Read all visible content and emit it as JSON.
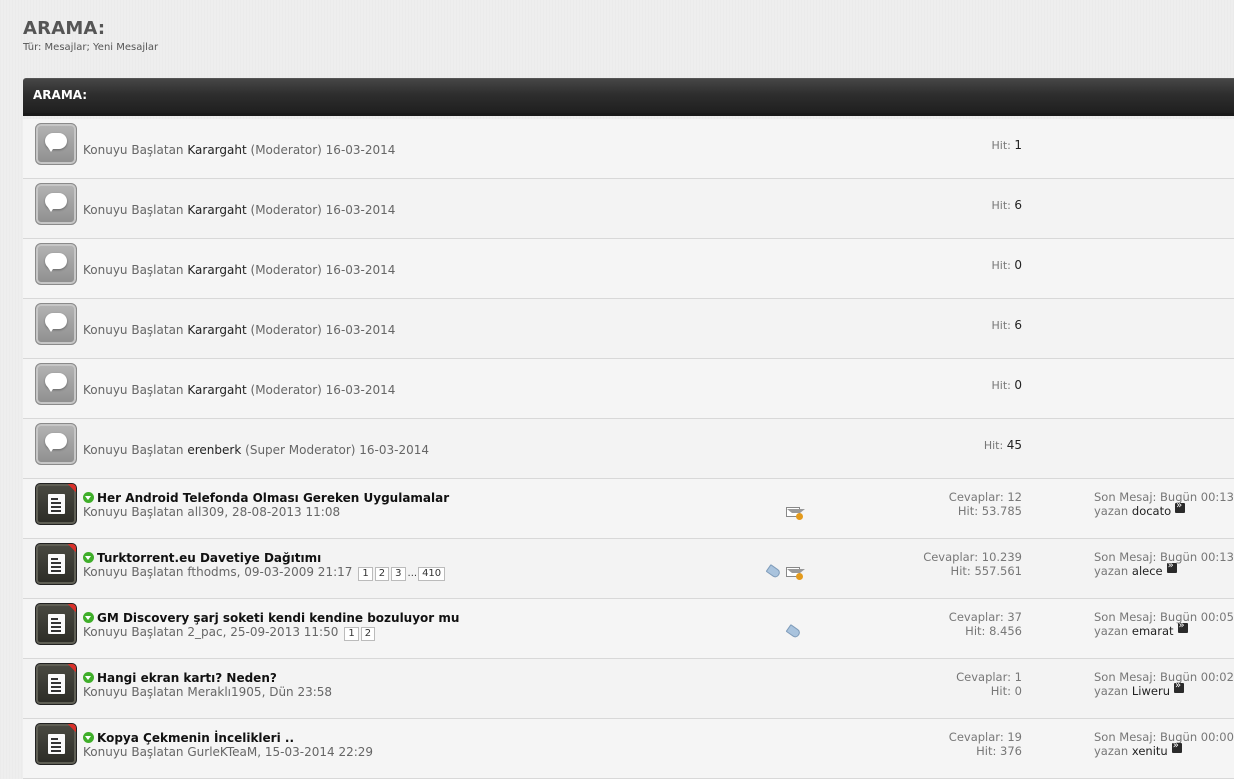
{
  "page": {
    "title": "ARAMA:",
    "subtitle": "Tür: Mesajlar; Yeni Mesajlar",
    "bar_title": "ARAMA:"
  },
  "labels": {
    "started_by": "Konuyu Başlatan",
    "hit": "Hit:",
    "replies": "Cevaplar:",
    "last_post": "Son Mesaj:",
    "by": "yazan"
  },
  "simple_rows": [
    {
      "author": "Karargaht",
      "role": "(Moderator)",
      "date": "16-03-2014",
      "hits": "1"
    },
    {
      "author": "Karargaht",
      "role": "(Moderator)",
      "date": "16-03-2014",
      "hits": "6"
    },
    {
      "author": "Karargaht",
      "role": "(Moderator)",
      "date": "16-03-2014",
      "hits": "0"
    },
    {
      "author": "Karargaht",
      "role": "(Moderator)",
      "date": "16-03-2014",
      "hits": "6"
    },
    {
      "author": "Karargaht",
      "role": "(Moderator)",
      "date": "16-03-2014",
      "hits": "0"
    },
    {
      "author": "erenberk",
      "role": "(Super Moderator)",
      "date": "16-03-2014",
      "hits": "45"
    }
  ],
  "threads": [
    {
      "title": "Her Android Telefonda Olması Gereken Uygulamalar",
      "author": "all309",
      "date": "28-08-2013 11:08",
      "replies": "12",
      "hits": "53.785",
      "last_time": "Bugün 00:13",
      "last_user": "docato",
      "pages": [],
      "icons": [
        "mail"
      ]
    },
    {
      "title": "Turktorrent.eu Davetiye Dağıtımı",
      "author": "fthodms",
      "date": "09-03-2009 21:17",
      "replies": "10.239",
      "hits": "557.561",
      "last_time": "Bugün 00:13",
      "last_user": "alece",
      "pages": [
        "1",
        "2",
        "3",
        "...",
        "410"
      ],
      "icons": [
        "tag",
        "mail"
      ]
    },
    {
      "title": "GM Discovery şarj soketi kendi kendine bozuluyor mu",
      "author": "2_pac",
      "date": "25-09-2013 11:50",
      "replies": "37",
      "hits": "8.456",
      "last_time": "Bugün 00:05",
      "last_user": "emarat",
      "pages": [
        "1",
        "2"
      ],
      "icons": [
        "tag"
      ]
    },
    {
      "title": "Hangi ekran kartı? Neden?",
      "author": "Meraklı1905",
      "date": "Dün 23:58",
      "replies": "1",
      "hits": "0",
      "last_time": "Bugün 00:02",
      "last_user": "Liweru",
      "pages": [],
      "icons": []
    },
    {
      "title": "Kopya Çekmenin İncelikleri ..",
      "author": "GurleKTeaM",
      "date": "15-03-2014 22:29",
      "replies": "19",
      "hits": "376",
      "last_time": "Bugün 00:00",
      "last_user": "xenitu",
      "pages": [],
      "icons": []
    }
  ],
  "icons": {
    "simple_row": "speech-bubble-icon",
    "thread_row": "new-thread-document-icon",
    "new_post": "green-arrow-down-icon",
    "goto_last": "goto-last-post-icon",
    "mail": "mail-icon",
    "tag": "tag-icon"
  }
}
